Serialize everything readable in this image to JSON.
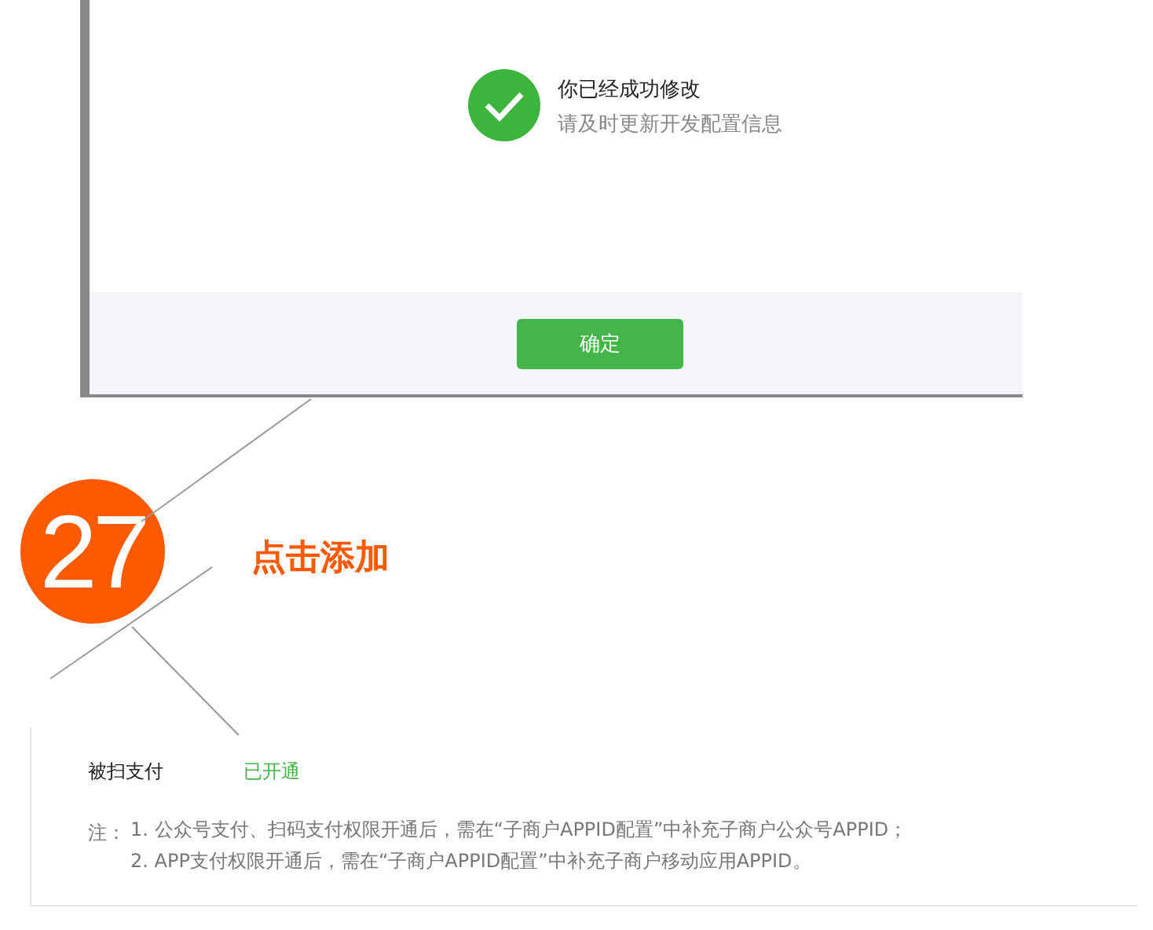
{
  "dialog": {
    "title": "你已经成功修改",
    "message": "请及时更新开发配置信息",
    "confirm_button": "确定"
  },
  "step": {
    "number": "27",
    "label": "点击添加"
  },
  "permission": {
    "name": "被扫支付",
    "status": "已开通"
  },
  "notes": {
    "prefix": "注：",
    "items": [
      "1. 公众号支付、扫码支付权限开通后，需在“子商户APPID配置”中补充子商户公众号APPID；",
      "2. APP支付权限开通后，需在“子商户APPID配置”中补充子商户移动应用APPID。"
    ]
  }
}
